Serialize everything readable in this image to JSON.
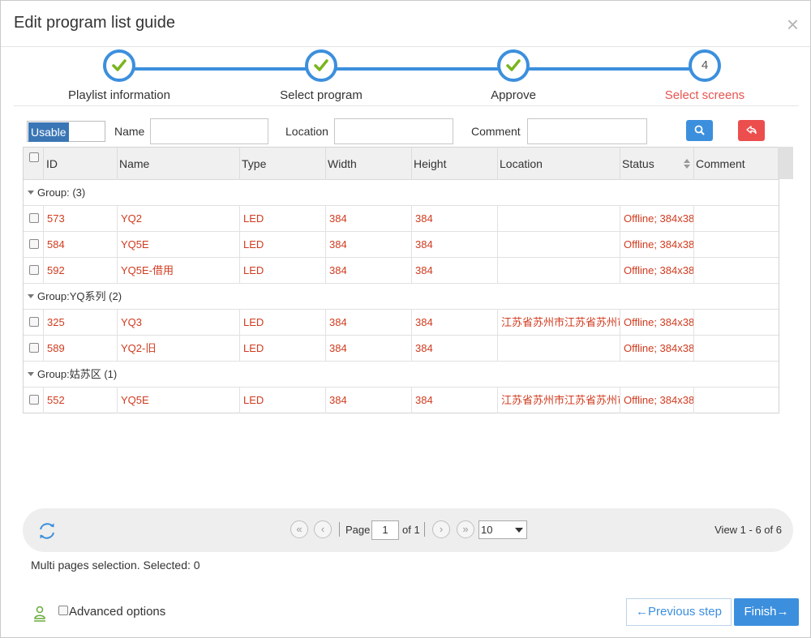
{
  "dialog": {
    "title": "Edit program list guide",
    "close_label": "×"
  },
  "wizard": {
    "steps": [
      {
        "label": "Playlist information",
        "state": "done"
      },
      {
        "label": "Select program",
        "state": "done"
      },
      {
        "label": "Approve",
        "state": "done"
      },
      {
        "label": "Select screens",
        "state": "active",
        "number": "4"
      }
    ]
  },
  "filter": {
    "status_value": "Usable",
    "name_label": "Name",
    "location_label": "Location",
    "comment_label": "Comment",
    "search_icon": "search-icon",
    "reset_icon": "reset-icon"
  },
  "grid": {
    "columns": [
      "ID",
      "Name",
      "Type",
      "Width",
      "Height",
      "Location",
      "Status",
      "Comment"
    ],
    "groups": [
      {
        "label": "Group: (3)",
        "rows": [
          {
            "id": "573",
            "name": "YQ2",
            "type": "LED",
            "width": "384",
            "height": "384",
            "location": "",
            "status": "Offline; 384x38",
            "comment": ""
          },
          {
            "id": "584",
            "name": "YQ5E",
            "type": "LED",
            "width": "384",
            "height": "384",
            "location": "",
            "status": "Offline; 384x38",
            "comment": ""
          },
          {
            "id": "592",
            "name": "YQ5E-借用",
            "type": "LED",
            "width": "384",
            "height": "384",
            "location": "",
            "status": "Offline; 384x38",
            "comment": ""
          }
        ]
      },
      {
        "label": "Group:YQ系列 (2)",
        "rows": [
          {
            "id": "325",
            "name": "YQ3",
            "type": "LED",
            "width": "384",
            "height": "384",
            "location": "江苏省苏州市江苏省苏州市",
            "status": "Offline; 384x38",
            "comment": ""
          },
          {
            "id": "589",
            "name": "YQ2-旧",
            "type": "LED",
            "width": "384",
            "height": "384",
            "location": "",
            "status": "Offline; 384x38",
            "comment": ""
          }
        ]
      },
      {
        "label": "Group:姑苏区 (1)",
        "rows": [
          {
            "id": "552",
            "name": "YQ5E",
            "type": "LED",
            "width": "384",
            "height": "384",
            "location": "江苏省苏州市江苏省苏州市",
            "status": "Offline; 384x38",
            "comment": ""
          }
        ]
      }
    ]
  },
  "pager": {
    "page_label": "Page",
    "page_value": "1",
    "of_label": "of 1",
    "page_size": "10",
    "view_text": "View 1 - 6 of 6"
  },
  "multi_selection_text": "Multi pages selection. Selected: 0",
  "footer": {
    "advanced_label": "Advanced options",
    "prev_label": "←Previous step",
    "finish_label": "Finish→"
  },
  "colors": {
    "accent": "#3c8fdd",
    "danger": "#ec4e4e",
    "row_text": "#d03b1f",
    "check": "#7ab51d"
  }
}
